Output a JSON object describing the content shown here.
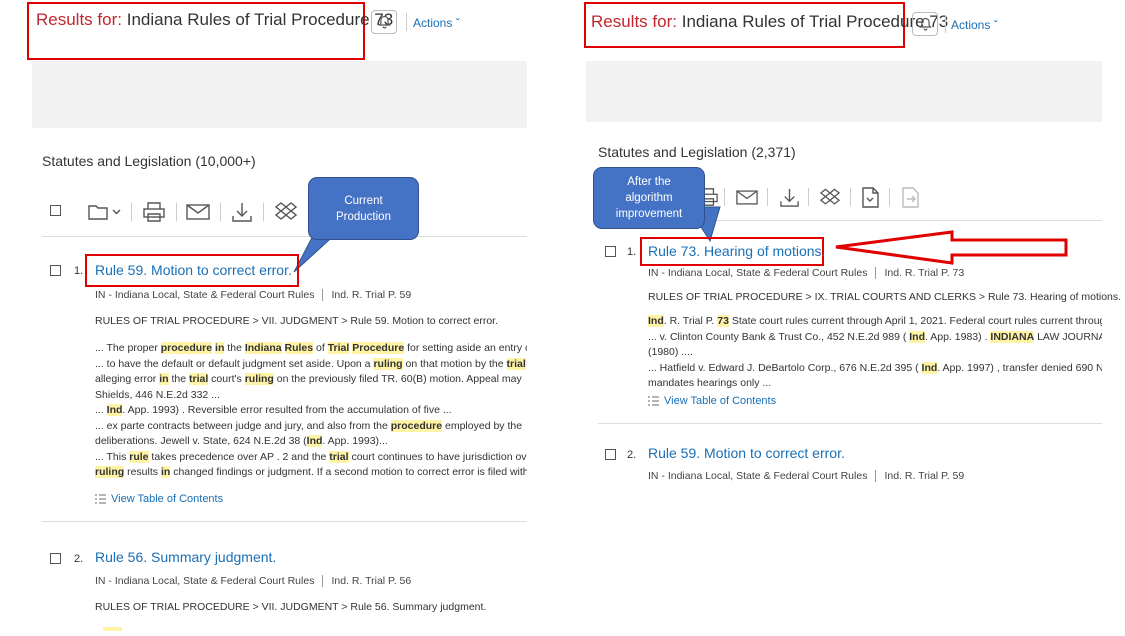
{
  "left": {
    "header": {
      "results_for": "Results for:",
      "query": "Indiana Rules of Trial Procedure 73",
      "actions": "Actions"
    },
    "section_title": "Statutes and Legislation (10,000+)",
    "callout": {
      "line1": "Current",
      "line2": "Production"
    },
    "results": [
      {
        "num": "1.",
        "title": "Rule 59. Motion to correct error.",
        "source": "IN - Indiana Local, State & Federal Court Rules",
        "cite": "Ind. R. Trial P. 59",
        "breadcrumb": "RULES OF TRIAL PROCEDURE > VII. JUDGMENT > Rule 59. Motion to correct error.",
        "snippets": [
          "... The proper <mark>procedure</mark> <mark>in</mark> the <mark>Indiana</mark> <mark>Rules</mark> of <mark>Trial</mark> <mark>Procedure</mark> for setting aside an entry of",
          "... to have the default or default judgment set aside. Upon a <mark>ruling</mark> on that motion by the <mark>trial</mark> court",
          "alleging error <mark>in</mark> the <mark>trial</mark> court's <mark>ruling</mark> on the previously filed TR. 60(B) motion. Appeal may",
          "Shields, 446 N.E.2d 332 ...",
          "... <mark>Ind</mark>. App. 1993) . Reversible error resulted from the accumulation of five ...",
          "... ex parte contracts between judge and jury, and also from the <mark>procedure</mark> employed by the",
          "deliberations. Jewell v. State, 624 N.E.2d 38 (<mark>Ind</mark>. App. 1993)...",
          "... This <mark>rule</mark> takes precedence over AP . 2 and the <mark>trial</mark> court continues to have jurisdiction over",
          "<mark>ruling</mark> results <mark>in</mark> changed findings or judgment. If a second motion to correct error is filed with"
        ],
        "toc": "View Table of Contents"
      },
      {
        "num": "2.",
        "title": "Rule 56. Summary judgment.",
        "source": "IN - Indiana Local, State & Federal Court Rules",
        "cite": "Ind. R. Trial P. 56",
        "breadcrumb": "RULES OF TRIAL PROCEDURE > VII. JUDGMENT > Rule 56. Summary judgment."
      }
    ]
  },
  "right": {
    "header": {
      "results_for": "Results for:",
      "query": "Indiana Rules of Trial Procedure 73",
      "actions": "Actions"
    },
    "section_title": "Statutes and Legislation (2,371)",
    "callout": {
      "line1": "After the",
      "line2": "algorithm",
      "line3": "improvement"
    },
    "results": [
      {
        "num": "1.",
        "title": "Rule 73. Hearing of motions.",
        "source": "IN - Indiana Local, State & Federal Court Rules",
        "cite": "Ind. R. Trial P. 73",
        "breadcrumb": "RULES OF TRIAL PROCEDURE > IX. TRIAL COURTS AND CLERKS > Rule 73. Hearing of motions.",
        "snippets": [
          "<mark>Ind</mark>. R. Trial P. <mark>73</mark> State court rules current through April 1, 2021. Federal court rules current through",
          "... v. Clinton County Bank & Trust Co., 452 N.E.2d 989 ( <mark>Ind</mark>. App. 1983) . <mark>INDIANA</mark> LAW JOURNAL. Vol.",
          "(1980) ....",
          "... Hatfield v. Edward J. DeBartolo Corp., 676 N.E.2d 395 ( <mark>Ind</mark>. App. 1997) , transfer denied 690 N.E.2d",
          "mandates hearings only ..."
        ],
        "toc": "View Table of Contents"
      },
      {
        "num": "2.",
        "title": "Rule 59. Motion to correct error.",
        "source": "IN - Indiana Local, State & Federal Court Rules",
        "cite": "Ind. R. Trial P. 59"
      }
    ]
  },
  "colors": {
    "accent": "#1a6fb5",
    "highlight_box": "#e00000",
    "callout": "#4472c4",
    "results_for": "#c0272d",
    "mark": "#fff3a6"
  },
  "icons": [
    "bell-icon",
    "chevron-down-icon",
    "folder-icon",
    "print-icon",
    "email-icon",
    "download-icon",
    "dropbox-icon",
    "document-icon",
    "export-icon",
    "list-icon"
  ]
}
